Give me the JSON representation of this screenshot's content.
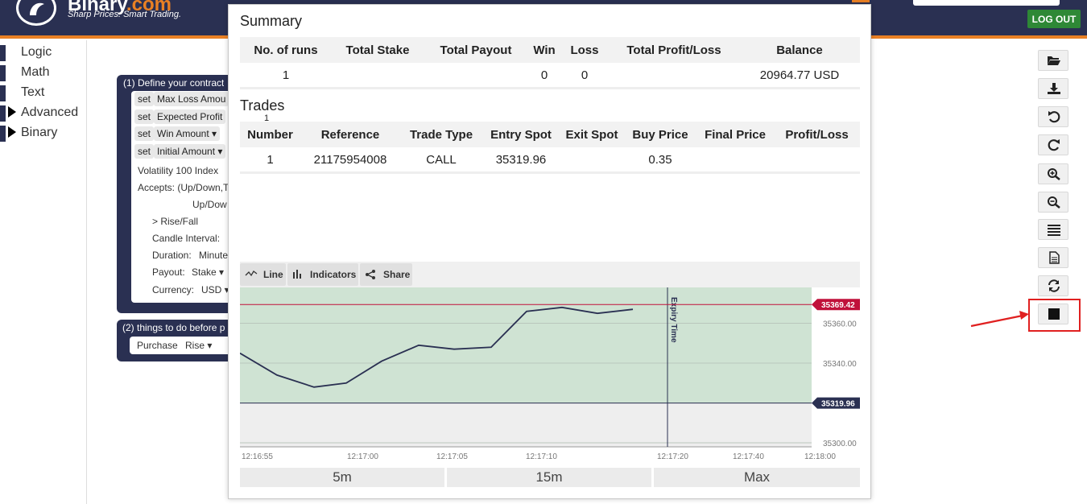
{
  "header": {
    "brand_name": "Binary",
    "brand_suffix": ".com",
    "tagline": "Sharp Prices. Smart Trading.",
    "logout_label": "LOG OUT"
  },
  "sidebar": {
    "items": [
      {
        "label": "Logic"
      },
      {
        "label": "Math"
      },
      {
        "label": "Text"
      },
      {
        "label": "Advanced"
      },
      {
        "label": "Binary"
      }
    ]
  },
  "workspace": {
    "block1_title": "(1) Define your contract",
    "set_label": "set",
    "vars": [
      "Max Loss Amou",
      "Expected Profit",
      "Win Amount",
      "Initial Amount"
    ],
    "market": "Volatility 100 Index",
    "accepts": "Accepts: (Up/Down,T",
    "updown": "Up/Dow",
    "risefall": "> Rise/Fall",
    "candle_interval": "Candle Interval:",
    "duration": "Duration:",
    "duration_value": "Minute",
    "payout": "Payout:",
    "payout_value": "Stake",
    "currency": "Currency:",
    "currency_value": "USD",
    "block2_title": "(2) things to do before p",
    "purchase": "Purchase",
    "purchase_value": "Rise"
  },
  "summary": {
    "title": "Summary",
    "headers": [
      "No. of runs",
      "Total Stake",
      "Total Payout",
      "Win",
      "Loss",
      "Total Profit/Loss",
      "Balance"
    ],
    "row": [
      "1",
      "",
      "",
      "0",
      "0",
      "",
      "20964.77 USD"
    ]
  },
  "trades": {
    "title": "Trades",
    "badge": "1",
    "headers": [
      "Number",
      "Reference",
      "Trade Type",
      "Entry Spot",
      "Exit Spot",
      "Buy Price",
      "Final Price",
      "Profit/Loss"
    ],
    "row": [
      "1",
      "21175954008",
      "CALL",
      "35319.96",
      "",
      "0.35",
      "",
      ""
    ]
  },
  "chart_toolbar": {
    "line_label": "Line",
    "indicators_label": "Indicators",
    "share_label": "Share"
  },
  "chart_data": {
    "type": "line",
    "x": [
      "12:16:55",
      "12:16:57",
      "12:16:59",
      "12:17:01",
      "12:17:03",
      "12:17:05",
      "12:17:07",
      "12:17:09",
      "12:17:11",
      "12:17:13",
      "12:17:15",
      "12:17:17"
    ],
    "values": [
      35345,
      35334,
      35328,
      35330,
      35341,
      35349,
      35347,
      35348,
      35366,
      35368,
      35365,
      35367
    ],
    "xticks": [
      "12:16:55",
      "12:17:00",
      "12:17:05",
      "12:17:10",
      "12:17:20",
      "12:17:40",
      "12:18:00"
    ],
    "yticks": [
      35360.0,
      35340.0,
      35320.0,
      35300.0
    ],
    "ylim": [
      35298,
      35378
    ],
    "current_price_label": "35369.42",
    "entry_spot_label": "35319.96",
    "expiry_label": "Expiry Time",
    "colors": {
      "area": "#cfe3d3",
      "line": "#2a3052",
      "current": "#c0113a",
      "entry": "#2a3052"
    }
  },
  "range_buttons": [
    "5m",
    "15m",
    "Max"
  ]
}
